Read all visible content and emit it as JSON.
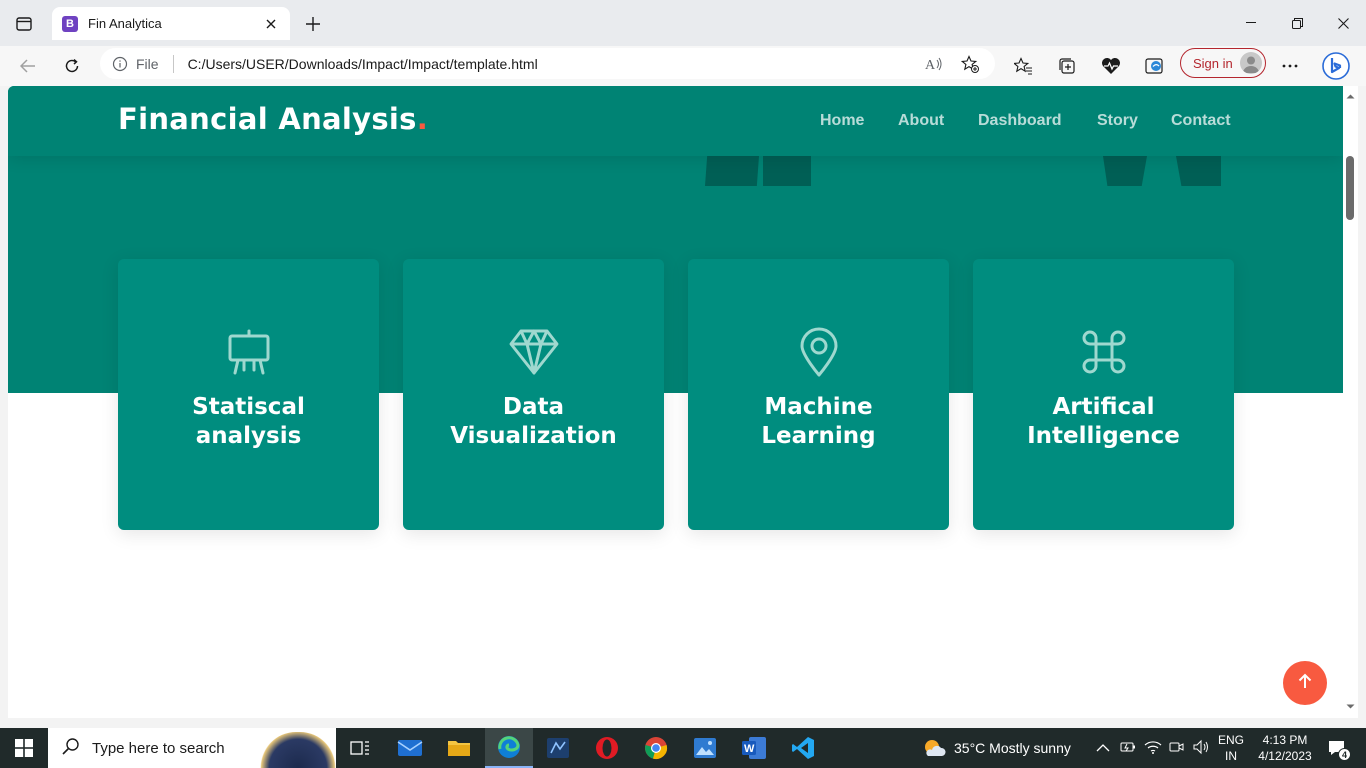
{
  "browser": {
    "tab_title": "Fin Analytica",
    "tab_favicon_letter": "B",
    "address": {
      "scheme_label": "File",
      "url": "C:/Users/USER/Downloads/Impact/Impact/template.html"
    },
    "signin_label": "Sign in"
  },
  "site": {
    "logo_text": "Financial Analysis",
    "logo_dot": ".",
    "nav": [
      "Home",
      "About",
      "Dashboard",
      "Story",
      "Contact"
    ],
    "cards": [
      {
        "title": "Statiscal analysis",
        "icon": "easel-icon"
      },
      {
        "title": "Data Visualization",
        "icon": "gem-icon"
      },
      {
        "title": "Machine Learning",
        "icon": "geo-pin-icon"
      },
      {
        "title": "Artifical Intelligence",
        "icon": "command-icon"
      }
    ],
    "colors": {
      "primary": "#008374",
      "card": "#008d7f",
      "accent": "#f85a40"
    }
  },
  "taskbar": {
    "search_placeholder": "Type here to search",
    "weather": "35°C  Mostly sunny",
    "lang_top": "ENG",
    "lang_bottom": "IN",
    "time": "4:13 PM",
    "date": "4/12/2023",
    "notification_count": "4"
  }
}
